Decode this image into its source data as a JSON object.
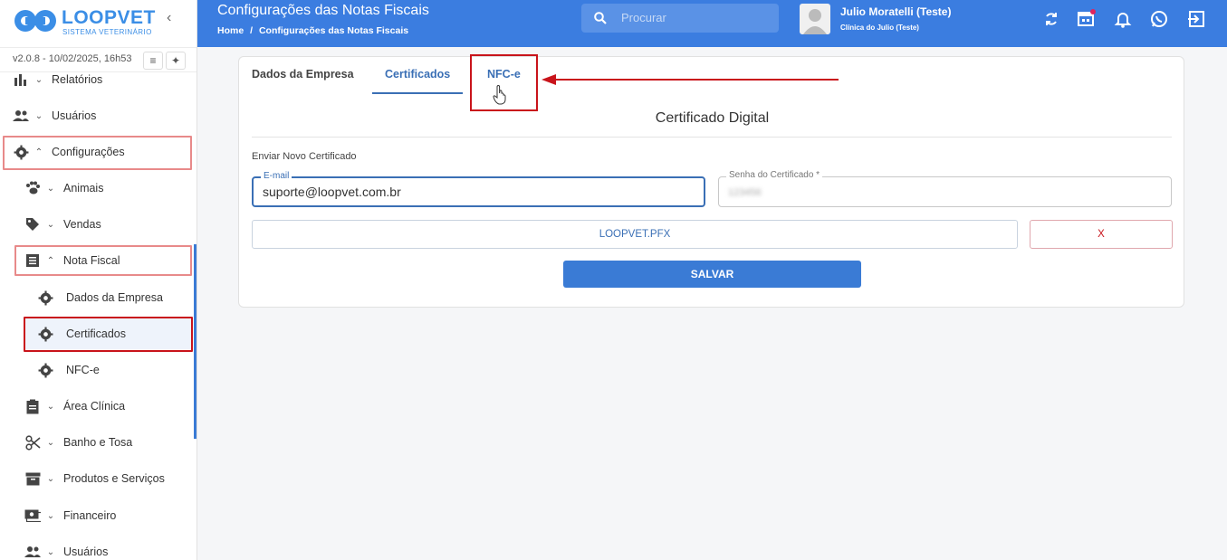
{
  "brand": {
    "name": "LOOPVET",
    "subtitle": "SISTEMA VETERINÁRIO",
    "version": "v2.0.8 - 10/02/2025, 16h53"
  },
  "sidebar": {
    "items": [
      {
        "label": "Relatórios",
        "icon": "chart-icon",
        "expanded": false
      },
      {
        "label": "Usuários",
        "icon": "users-icon",
        "expanded": false
      },
      {
        "label": "Configurações",
        "icon": "gear-icon",
        "expanded": true
      },
      {
        "label": "Animais",
        "icon": "paw-icon",
        "expanded": false
      },
      {
        "label": "Vendas",
        "icon": "tag-icon",
        "expanded": false
      },
      {
        "label": "Nota Fiscal",
        "icon": "document-icon",
        "expanded": true
      },
      {
        "label": "Dados da Empresa",
        "icon": "gear-icon"
      },
      {
        "label": "Certificados",
        "icon": "gear-icon",
        "selected": true
      },
      {
        "label": "NFC-e",
        "icon": "gear-icon"
      },
      {
        "label": "Área Clínica",
        "icon": "clipboard-icon",
        "expanded": false
      },
      {
        "label": "Banho e Tosa",
        "icon": "scissors-icon",
        "expanded": false
      },
      {
        "label": "Produtos e Serviços",
        "icon": "archive-icon",
        "expanded": false
      },
      {
        "label": "Financeiro",
        "icon": "money-icon",
        "expanded": false
      },
      {
        "label": "Usuários",
        "icon": "users-icon",
        "expanded": false
      }
    ]
  },
  "header": {
    "title": "Configurações das Notas Fiscais",
    "breadcrumb_home": "Home",
    "breadcrumb_sep": "/",
    "breadcrumb_current": "Configurações das Notas Fiscais",
    "search_placeholder": "Procurar",
    "user_name": "Julio Moratelli (Teste)",
    "user_clinic": "Clínica do Julio (Teste)",
    "icons": [
      "sync-icon",
      "calendar-icon",
      "bell-icon",
      "whatsapp-icon",
      "logout-icon"
    ]
  },
  "tabs": [
    {
      "label": "Dados da Empresa",
      "active": false
    },
    {
      "label": "Certificados",
      "active": true
    },
    {
      "label": "NFC-e",
      "active": false
    }
  ],
  "form": {
    "section_title": "Certificado Digital",
    "subsection": "Enviar Novo Certificado",
    "email_label": "E-mail",
    "email_value": "suporte@loopvet.com.br",
    "password_label": "Senha do Certificado *",
    "password_value": "123456",
    "file_name": "LOOPVET.PFX",
    "remove_label": "X",
    "save_label": "SALVAR"
  },
  "colors": {
    "primary": "#3b7de0",
    "accent": "#3a6fb5",
    "annotation": "#c9141b"
  }
}
